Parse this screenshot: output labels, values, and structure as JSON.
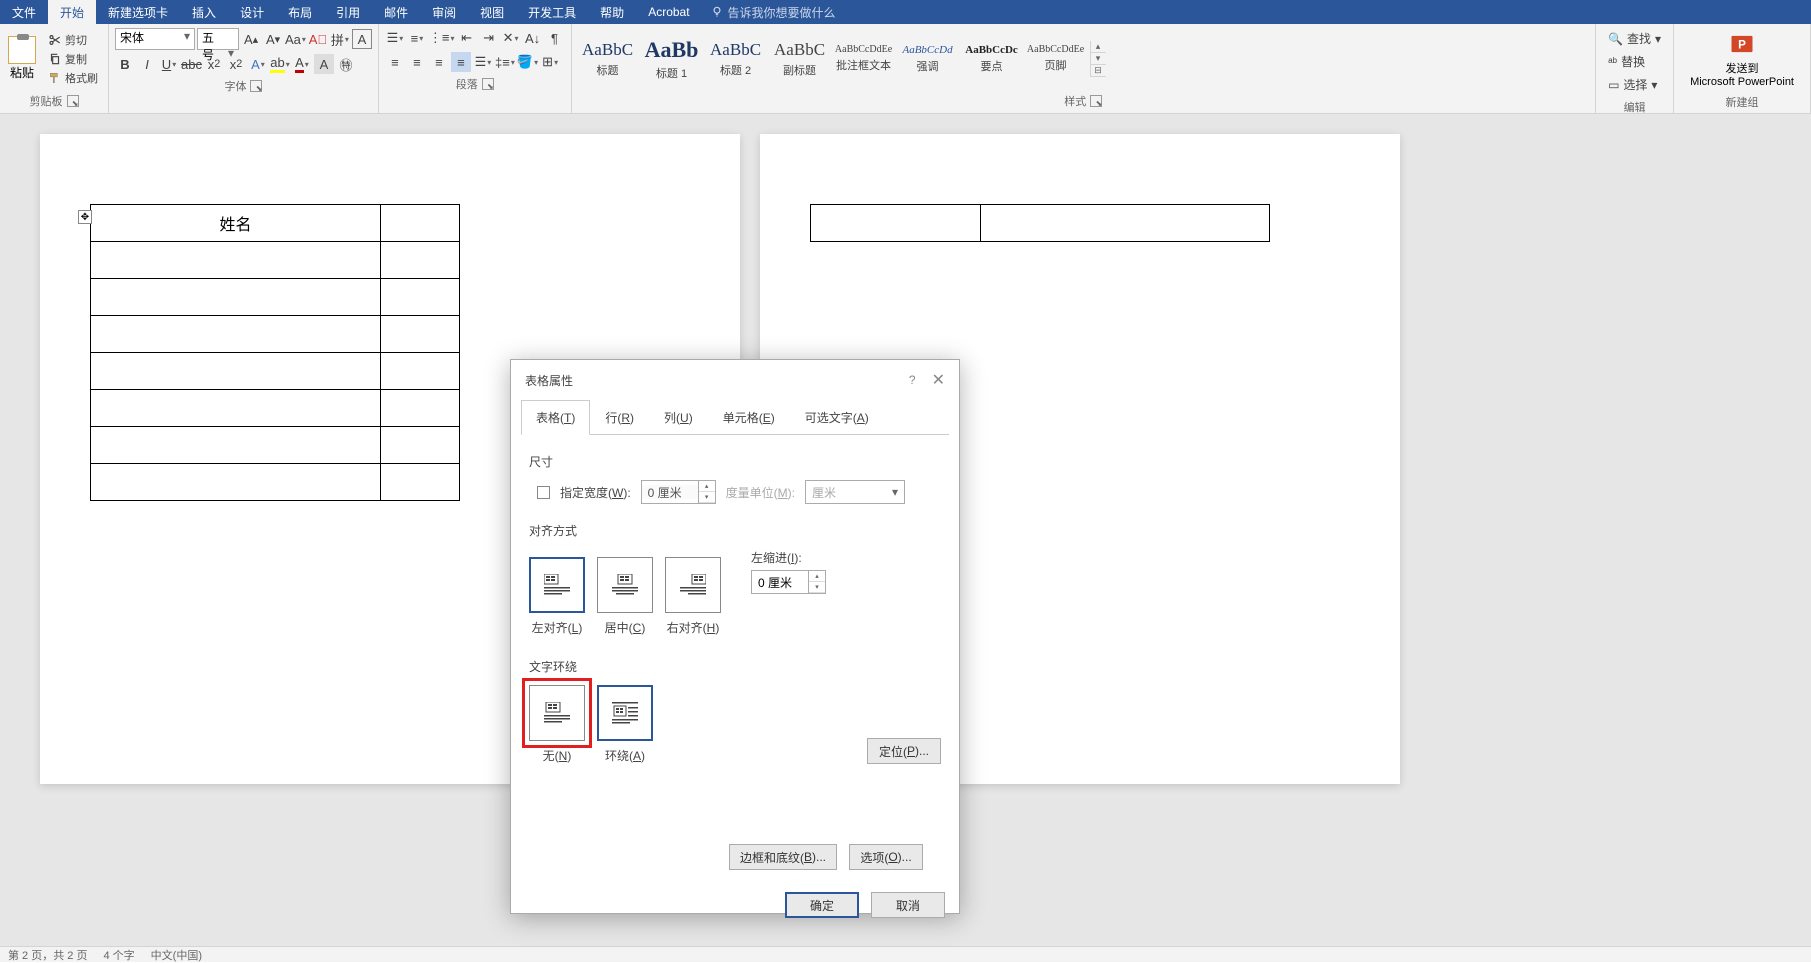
{
  "menu": {
    "file": "文件",
    "home": "开始",
    "new_tab": "新建选项卡",
    "insert": "插入",
    "design": "设计",
    "layout": "布局",
    "references": "引用",
    "mailings": "邮件",
    "review": "审阅",
    "view": "视图",
    "developer": "开发工具",
    "help": "帮助",
    "acrobat": "Acrobat",
    "tell_me": "告诉我你想要做什么"
  },
  "clipboard": {
    "paste": "粘贴",
    "cut": "剪切",
    "copy": "复制",
    "format_painter": "格式刷",
    "group": "剪贴板"
  },
  "font": {
    "name": "宋体",
    "size": "五号",
    "group": "字体"
  },
  "paragraph": {
    "group": "段落"
  },
  "styles": {
    "group": "样式",
    "items": [
      {
        "preview": "AaBbC",
        "name": "标题",
        "size": "17px",
        "weight": "normal",
        "color": "#1f3864"
      },
      {
        "preview": "AaBb",
        "name": "标题 1",
        "size": "22px",
        "weight": "bold",
        "color": "#1f3864"
      },
      {
        "preview": "AaBbC",
        "name": "标题 2",
        "size": "17px",
        "weight": "normal",
        "color": "#1f3864"
      },
      {
        "preview": "AaBbC",
        "name": "副标题",
        "size": "17px",
        "weight": "normal",
        "color": "#444"
      },
      {
        "preview": "AaBbCcDdEe",
        "name": "批注框文本",
        "size": "10px",
        "weight": "normal",
        "color": "#444"
      },
      {
        "preview": "AaBbCcDd",
        "name": "强调",
        "size": "11px",
        "weight": "normal",
        "color": "#2b579a",
        "italic": true
      },
      {
        "preview": "AaBbCcDc",
        "name": "要点",
        "size": "11px",
        "weight": "bold",
        "color": "#222"
      },
      {
        "preview": "AaBbCcDdEe",
        "name": "页脚",
        "size": "10px",
        "weight": "normal",
        "color": "#444"
      }
    ]
  },
  "editing": {
    "find": "查找",
    "replace": "替换",
    "select": "选择",
    "group": "编辑"
  },
  "send": {
    "label1": "发送到",
    "label2": "Microsoft PowerPoint",
    "group": "新建组"
  },
  "document": {
    "table_header": "姓名"
  },
  "dialog": {
    "title": "表格属性",
    "tabs": {
      "table": "表格(T)",
      "row": "行(R)",
      "column": "列(U)",
      "cell": "单元格(E)",
      "alt_text": "可选文字(A)"
    },
    "size_label": "尺寸",
    "width_check": "指定宽度(W):",
    "width_value": "0 厘米",
    "unit_label": "度量单位(M):",
    "unit_value": "厘米",
    "align_label": "对齐方式",
    "align_left": "左对齐(L)",
    "align_center": "居中(C)",
    "align_right": "右对齐(H)",
    "indent_label": "左缩进(I):",
    "indent_value": "0 厘米",
    "wrap_label": "文字环绕",
    "wrap_none": "无(N)",
    "wrap_around": "环绕(A)",
    "position_btn": "定位(P)...",
    "borders_btn": "边框和底纹(B)...",
    "options_btn": "选项(O)...",
    "ok": "确定",
    "cancel": "取消"
  },
  "status": {
    "page": "第 2 页，共 2 页",
    "words": "4 个字",
    "lang": "中文(中国)"
  }
}
